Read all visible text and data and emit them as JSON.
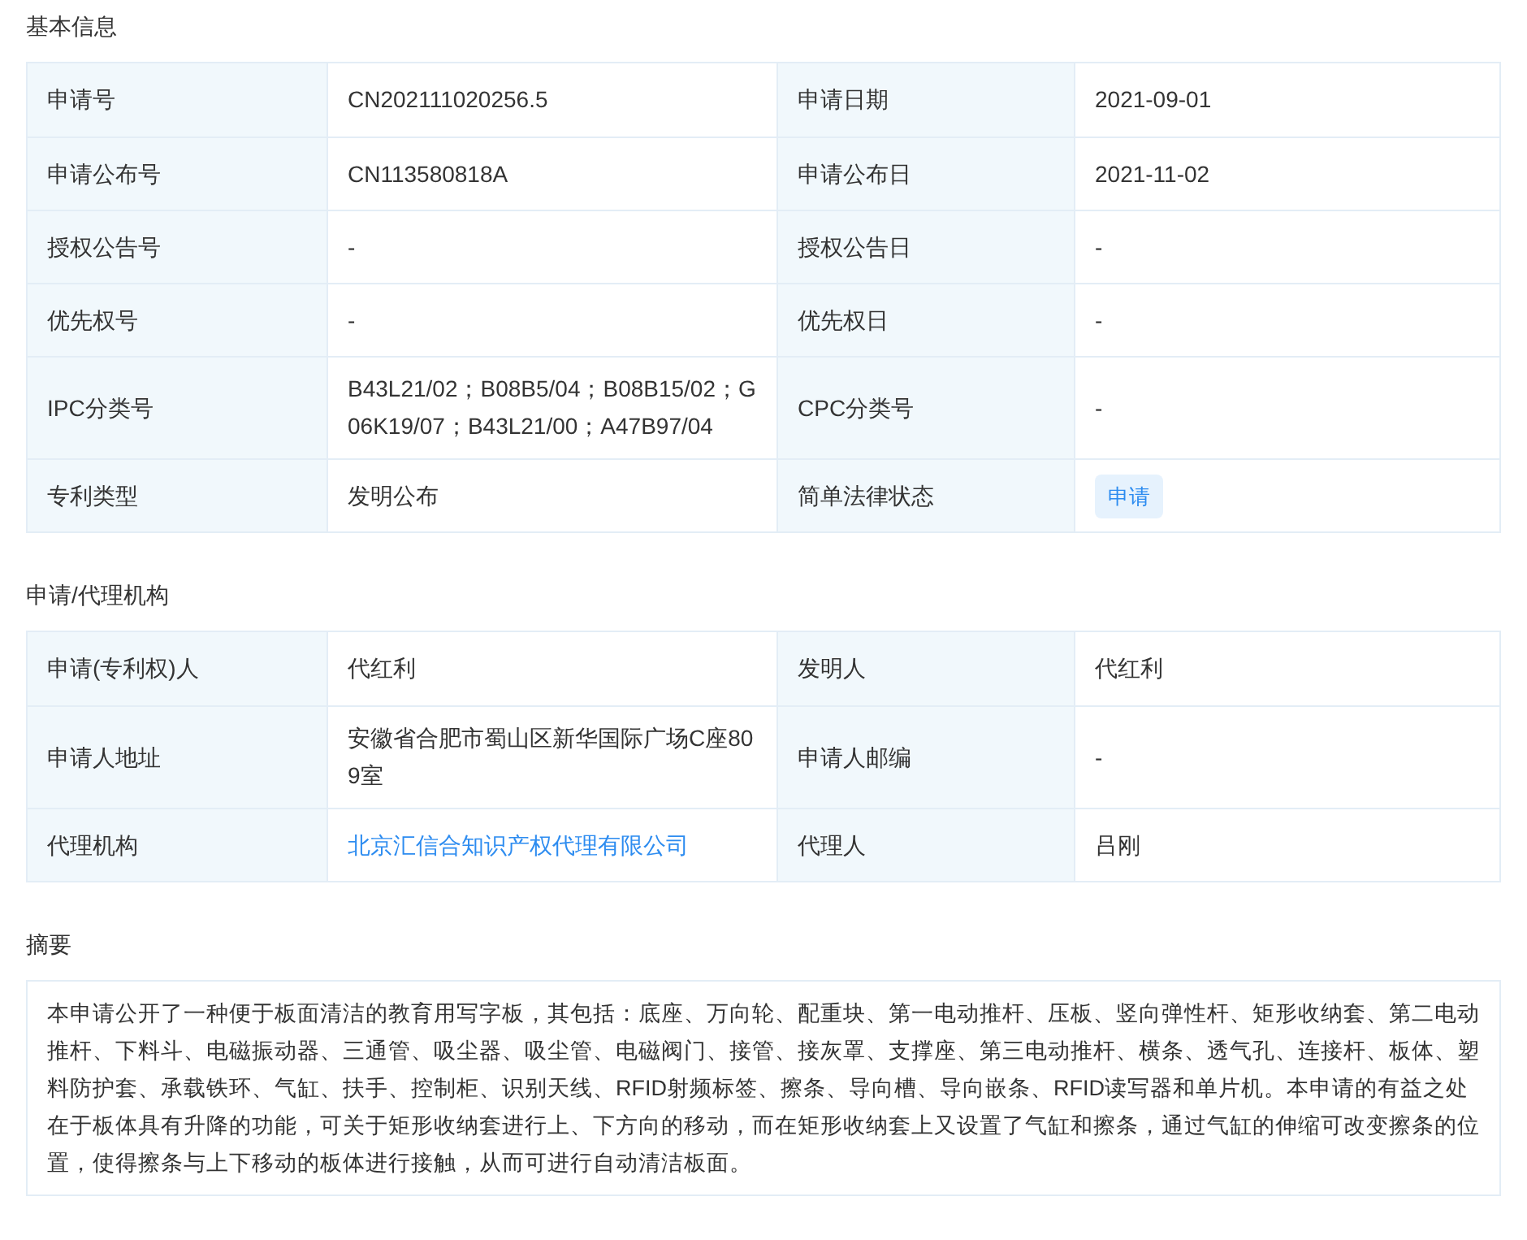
{
  "sections": [
    {
      "title": "基本信息",
      "rows": [
        [
          {
            "label": "申请号",
            "value": "CN202111020256.5",
            "kind": "text"
          },
          {
            "label": "申请日期",
            "value": "2021-09-01",
            "kind": "text"
          }
        ],
        [
          {
            "label": "申请公布号",
            "value": "CN113580818A",
            "kind": "text"
          },
          {
            "label": "申请公布日",
            "value": "2021-11-02",
            "kind": "text"
          }
        ],
        [
          {
            "label": "授权公告号",
            "value": "-",
            "kind": "text"
          },
          {
            "label": "授权公告日",
            "value": "-",
            "kind": "text"
          }
        ],
        [
          {
            "label": "优先权号",
            "value": "-",
            "kind": "text"
          },
          {
            "label": "优先权日",
            "value": "-",
            "kind": "text"
          }
        ],
        [
          {
            "label": "IPC分类号",
            "value": "B43L21/02；B08B5/04；B08B15/02；G06K19/07；B43L21/00；A47B97/04",
            "kind": "text"
          },
          {
            "label": "CPC分类号",
            "value": "-",
            "kind": "text"
          }
        ],
        [
          {
            "label": "专利类型",
            "value": "发明公布",
            "kind": "text"
          },
          {
            "label": "简单法律状态",
            "value": "申请",
            "kind": "tag"
          }
        ]
      ]
    },
    {
      "title": "申请/代理机构",
      "rows": [
        [
          {
            "label": "申请(专利权)人",
            "value": "代红利",
            "kind": "text"
          },
          {
            "label": "发明人",
            "value": "代红利",
            "kind": "text"
          }
        ],
        [
          {
            "label": "申请人地址",
            "value": "安徽省合肥市蜀山区新华国际广场C座809室",
            "kind": "text"
          },
          {
            "label": "申请人邮编",
            "value": "-",
            "kind": "text"
          }
        ],
        [
          {
            "label": "代理机构",
            "value": "北京汇信合知识产权代理有限公司",
            "kind": "link"
          },
          {
            "label": "代理人",
            "value": "吕刚",
            "kind": "text"
          }
        ]
      ]
    }
  ],
  "abstract": {
    "title": "摘要",
    "text": "本申请公开了一种便于板面清洁的教育用写字板，其包括：底座、万向轮、配重块、第一电动推杆、压板、竖向弹性杆、矩形收纳套、第二电动推杆、下料斗、电磁振动器、三通管、吸尘器、吸尘管、电磁阀门、接管、接灰罩、支撑座、第三电动推杆、横条、透气孔、连接杆、板体、塑料防护套、承载铁环、气缸、扶手、控制柜、识别天线、RFID射频标签、擦条、导向槽、导向嵌条、RFID读写器和单片机。本申请的有益之处在于板体具有升降的功能，可关于矩形收纳套进行上、下方向的移动，而在矩形收纳套上又设置了气缸和擦条，通过气缸的伸缩可改变擦条的位置，使得擦条与上下移动的板体进行接触，从而可进行自动清洁板面。"
  }
}
